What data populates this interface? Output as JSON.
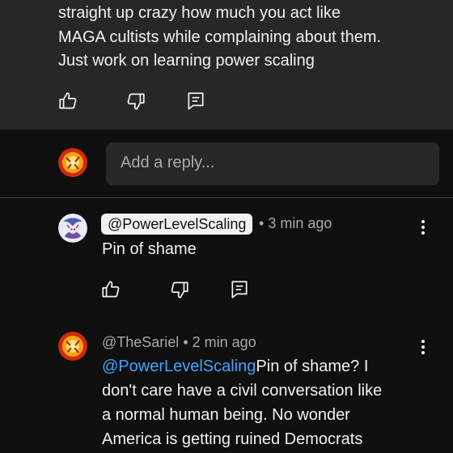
{
  "top_comment": {
    "lines": [
      "straight up crazy how much you act like",
      "MAGA cultists while complaining about them.",
      "Just work on learning power scaling"
    ]
  },
  "reply_input": {
    "placeholder": "Add a reply..."
  },
  "replies": [
    {
      "author": "@PowerLevelScaling",
      "separator": "•",
      "time": "3 min ago",
      "text": "Pin of shame"
    },
    {
      "author": "@TheSariel",
      "separator": "•",
      "time": "2 min ago",
      "mention": "@PowerLevelScaling",
      "lines": [
        "Pin of shame? I",
        "don't care have a civil conversation like",
        "a normal human being. No wonder",
        "America is getting ruined Democrats"
      ]
    }
  ],
  "icons": {
    "like": "thumbs-up-icon",
    "dislike": "thumbs-down-icon",
    "reply": "reply-icon",
    "more": "more-vertical-icon"
  },
  "colors": {
    "background": "#0f0f0f",
    "panel": "#272727",
    "mention": "#3ea6ff",
    "secondary_text": "#aaaaaa"
  }
}
